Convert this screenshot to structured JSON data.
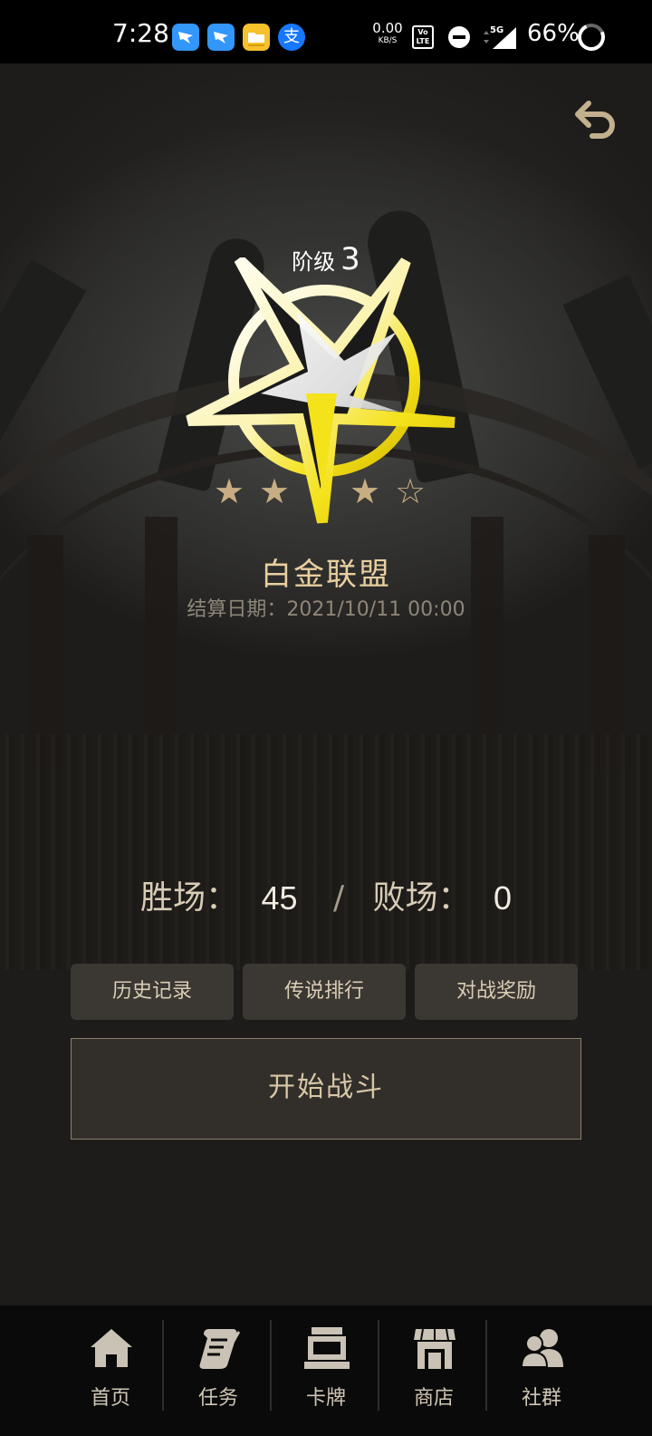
{
  "status_bar": {
    "time": "7:28",
    "net_speed_value": "0.00",
    "net_speed_unit": "KB/S",
    "volte_label": "Vo LTE",
    "signal_label": "5G",
    "battery_percent": "66%",
    "app_icons": [
      "dingtalk-icon",
      "dingtalk-icon",
      "folder-app-icon",
      "alipay-icon"
    ],
    "alipay_glyph": "支"
  },
  "header": {
    "back_icon": "back-arrow-icon"
  },
  "rank": {
    "label": "阶级",
    "level": "3",
    "stars_filled": 3,
    "stars_total": 4,
    "star_filled_glyph": "★",
    "star_empty_glyph": "☆",
    "league_name": "白金联盟",
    "settle_date_text": "结算日期：2021/10/11 00:00",
    "colors": {
      "gold": "#e8cfa0",
      "star": "#c8ad82",
      "emblem_yellow": "#f4e21a"
    }
  },
  "record": {
    "wins_label": "胜场：",
    "wins": "45",
    "separator": "/",
    "losses_label": "败场：",
    "losses": "0"
  },
  "actions": {
    "history_label": "历史记录",
    "legend_rank_label": "传说排行",
    "battle_rewards_label": "对战奖励",
    "start_battle_label": "开始战斗"
  },
  "bottom_nav": [
    {
      "label": "首页",
      "icon": "home-icon"
    },
    {
      "label": "任务",
      "icon": "quest-scroll-icon"
    },
    {
      "label": "卡牌",
      "icon": "cards-icon"
    },
    {
      "label": "商店",
      "icon": "shop-icon"
    },
    {
      "label": "社群",
      "icon": "community-icon"
    }
  ]
}
